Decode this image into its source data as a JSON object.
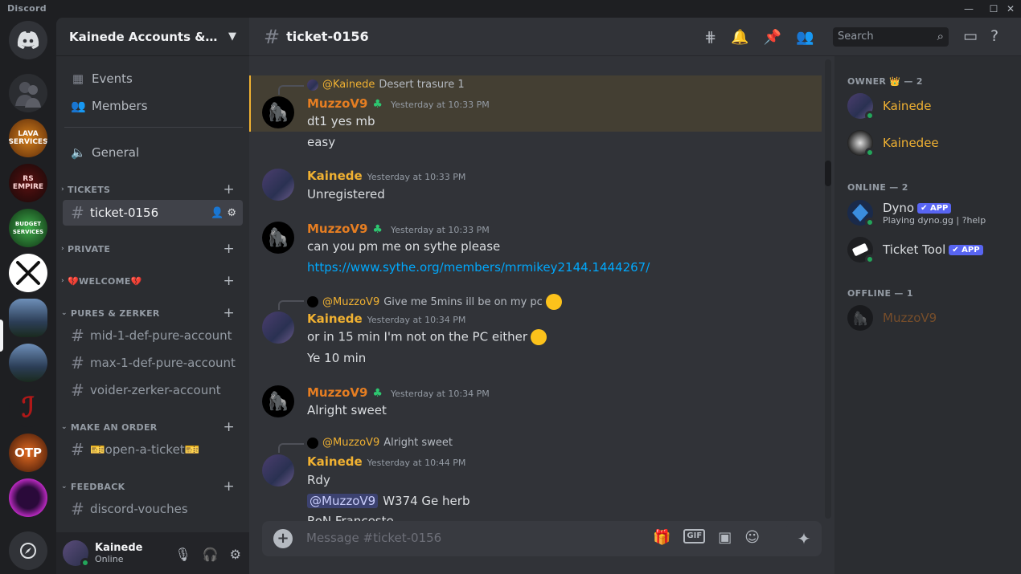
{
  "window": {
    "app_name": "Discord"
  },
  "rail": {
    "servers": [
      {
        "label": "LAVA SERVICES",
        "color": "#7a3f12"
      },
      {
        "label": "RS EMPIRE",
        "color": "#2a1a1a"
      },
      {
        "label": "BUDGET SERVICES",
        "color": "#1d4d25"
      },
      {
        "label": "",
        "color": "#ffffff"
      },
      {
        "label": "",
        "color": "#2d4a6e"
      },
      {
        "label": "",
        "color": "#2d4a6e"
      },
      {
        "label": "",
        "color": "#1e1f22"
      },
      {
        "label": "OTP",
        "color": "#6b2a12"
      },
      {
        "label": "",
        "color": "#7a1f8a"
      }
    ]
  },
  "sidebar": {
    "guild_name": "Kainede Accounts & Ser...",
    "top_items": [
      {
        "label": "Events",
        "icon": "calendar-icon"
      },
      {
        "label": "Members",
        "icon": "members-icon"
      },
      {
        "label": "General",
        "icon": "speaker-icon"
      }
    ],
    "categories": [
      {
        "name": "TICKETS",
        "channels": [
          "ticket-0156"
        ]
      },
      {
        "name": "PRIVATE",
        "channels": []
      },
      {
        "name": "💔WELCOME💔",
        "channels": []
      },
      {
        "name": "PURES & ZERKER",
        "channels": [
          "mid-1-def-pure-account",
          "max-1-def-pure-account",
          "voider-zerker-account"
        ]
      },
      {
        "name": "MAKE AN ORDER",
        "channels": [
          "🎫open-a-ticket🎫"
        ]
      },
      {
        "name": "FEEDBACK",
        "channels": [
          "discord-vouches"
        ]
      }
    ]
  },
  "user_panel": {
    "name": "Kainede",
    "status": "Online"
  },
  "chat": {
    "channel_name": "ticket-0156",
    "search_placeholder": "Search",
    "composer_placeholder": "Message #ticket-0156",
    "messages": [
      {
        "reply_to": "@Kainede",
        "reply_text": "Desert trasure 1",
        "author": "MuzzoV9",
        "time": "Yesterday at 10:33 PM",
        "lines": [
          "dt1 yes mb",
          "easy"
        ]
      },
      {
        "author": "Kainede",
        "time": "Yesterday at 10:33 PM",
        "lines": [
          "Unregistered"
        ]
      },
      {
        "author": "MuzzoV9",
        "time": "Yesterday at 10:33 PM",
        "lines": [
          "can you pm me on sythe please",
          "https://www.sythe.org/members/mrmikey2144.1444267/"
        ]
      },
      {
        "reply_to": "@MuzzoV9",
        "reply_text": "Give me 5mins ill be on my pc",
        "author": "Kainede",
        "time": "Yesterday at 10:34 PM",
        "lines": [
          "or in 15 min I'm not on the PC either",
          "Ye 10 min"
        ]
      },
      {
        "author": "MuzzoV9",
        "time": "Yesterday at 10:34 PM",
        "lines": [
          "Alright sweet"
        ]
      },
      {
        "reply_to": "@MuzzoV9",
        "reply_text": "Alright sweet",
        "author": "Kainede",
        "time": "Yesterday at 10:44 PM",
        "lines": [
          "Rdy",
          "W374 Ge herb",
          "RoN Franceste"
        ],
        "mention": "@MuzzoV9"
      }
    ]
  },
  "members": {
    "owner_header": "OWNER 👑 — 2",
    "online_header": "ONLINE — 2",
    "offline_header": "OFFLINE — 1",
    "owners": [
      "Kainede",
      "Kainedee"
    ],
    "online": [
      {
        "name": "Dyno",
        "badge": "✔ APP",
        "activity": "Playing dyno.gg | ?help"
      },
      {
        "name": "Ticket Tool",
        "badge": "✔ APP",
        "activity": ""
      }
    ],
    "offline": [
      "MuzzoV9"
    ]
  },
  "colors": {
    "owner_name": "#f0b132",
    "muzzo_name": "#e67e22",
    "link": "#00a8fc",
    "app_badge": "#5865f2",
    "online": "#23a55a"
  }
}
